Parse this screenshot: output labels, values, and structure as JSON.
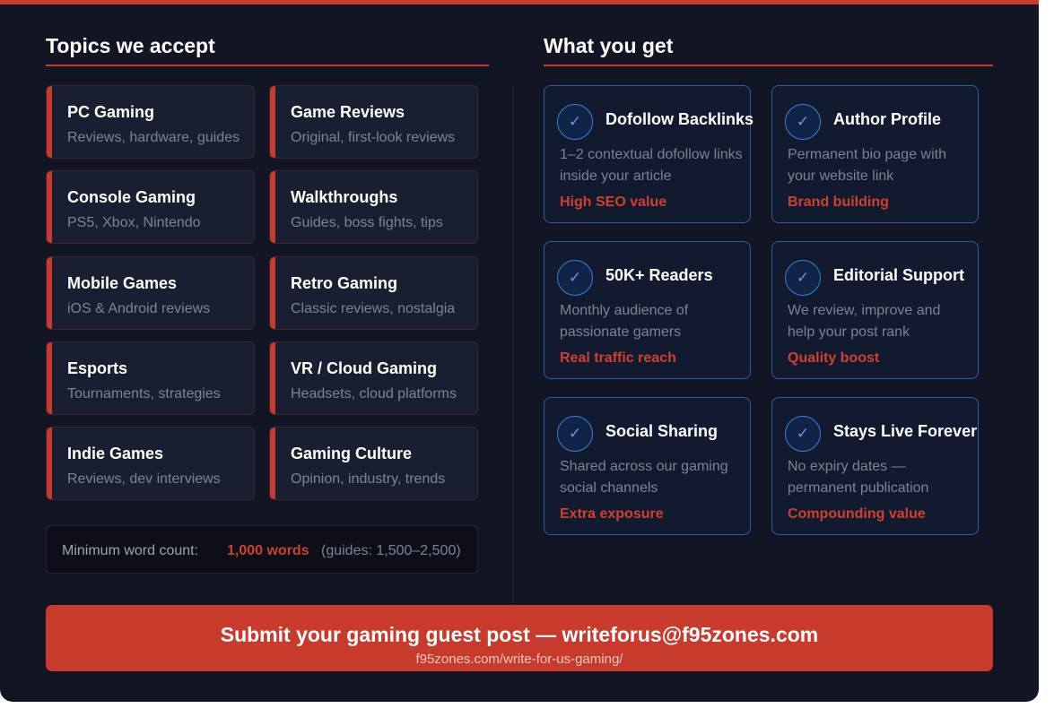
{
  "topics_section": {
    "title": "Topics we accept",
    "topics": [
      {
        "title": "PC Gaming",
        "subtitle": "Reviews, hardware, guides"
      },
      {
        "title": "Game Reviews",
        "subtitle": "Original, first-look reviews"
      },
      {
        "title": "Console Gaming",
        "subtitle": "PS5, Xbox, Nintendo"
      },
      {
        "title": "Walkthroughs",
        "subtitle": "Guides, boss fights, tips"
      },
      {
        "title": "Mobile Games",
        "subtitle": "iOS & Android reviews"
      },
      {
        "title": "Retro Gaming",
        "subtitle": "Classic reviews, nostalgia"
      },
      {
        "title": "Esports",
        "subtitle": "Tournaments, strategies"
      },
      {
        "title": "VR / Cloud Gaming",
        "subtitle": "Headsets, cloud platforms"
      },
      {
        "title": "Indie Games",
        "subtitle": "Reviews, dev interviews"
      },
      {
        "title": "Gaming Culture",
        "subtitle": "Opinion, industry, trends"
      }
    ],
    "word_count": {
      "label": "Minimum word count:",
      "value": "1,000 words",
      "note": "(guides: 1,500–2,500)"
    }
  },
  "benefits_section": {
    "title": "What you get",
    "check_icon": "✓",
    "benefits": [
      {
        "title": "Dofollow Backlinks",
        "desc": "1–2 contextual dofollow links inside your article",
        "tag": "High SEO value"
      },
      {
        "title": "Author Profile",
        "desc": "Permanent bio page with your website link",
        "tag": "Brand building"
      },
      {
        "title": "50K+ Readers",
        "desc": "Monthly audience of passionate gamers",
        "tag": "Real traffic reach"
      },
      {
        "title": "Editorial Support",
        "desc": "We review, improve and help your post rank",
        "tag": "Quality boost"
      },
      {
        "title": "Social Sharing",
        "desc": "Shared across our gaming social channels",
        "tag": "Extra exposure"
      },
      {
        "title": "Stays Live Forever",
        "desc": "No expiry dates — permanent publication",
        "tag": "Compounding value"
      }
    ]
  },
  "cta": {
    "main": "Submit your gaming guest post — writeforus@f95zones.com",
    "url": "f95zones.com/write-for-us-gaming/"
  },
  "colors": {
    "background": "#121624",
    "accent_red": "#c83a2c",
    "accent_blue": "#2b5fa5"
  }
}
